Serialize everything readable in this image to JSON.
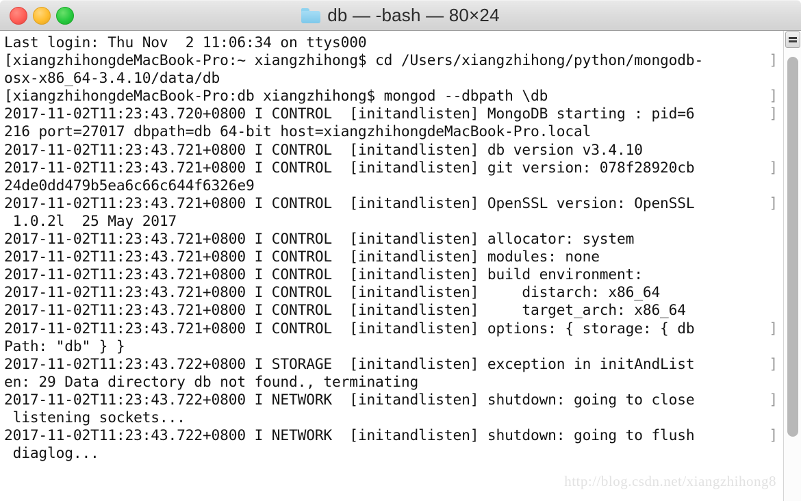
{
  "window": {
    "title": "db — -bash — 80×24",
    "folder_icon": "folder-icon",
    "traffic_lights": [
      {
        "name": "close-button",
        "label": "Close",
        "color": "#ff5f57"
      },
      {
        "name": "minimize-button",
        "label": "Minimize",
        "color": "#ffbd2e"
      },
      {
        "name": "maximize-button",
        "label": "Maximize",
        "color": "#28c940"
      }
    ]
  },
  "terminal": {
    "columns": 80,
    "rows": 24,
    "background": "#ffffff",
    "foreground": "#131313",
    "wrap_marker": "]",
    "lines": [
      "Last login: Thu Nov  2 11:06:34 on ttys000",
      "[xiangzhihongdeMacBook-Pro:~ xiangzhihong$ cd /Users/xiangzhihong/python/mongodb-",
      "osx-x86_64-3.4.10/data/db",
      "[xiangzhihongdeMacBook-Pro:db xiangzhihong$ mongod --dbpath \\db",
      "2017-11-02T11:23:43.720+0800 I CONTROL  [initandlisten] MongoDB starting : pid=6",
      "216 port=27017 dbpath=db 64-bit host=xiangzhihongdeMacBook-Pro.local",
      "2017-11-02T11:23:43.721+0800 I CONTROL  [initandlisten] db version v3.4.10",
      "2017-11-02T11:23:43.721+0800 I CONTROL  [initandlisten] git version: 078f28920cb",
      "24de0dd479b5ea6c66c644f6326e9",
      "2017-11-02T11:23:43.721+0800 I CONTROL  [initandlisten] OpenSSL version: OpenSSL",
      " 1.0.2l  25 May 2017",
      "2017-11-02T11:23:43.721+0800 I CONTROL  [initandlisten] allocator: system",
      "2017-11-02T11:23:43.721+0800 I CONTROL  [initandlisten] modules: none",
      "2017-11-02T11:23:43.721+0800 I CONTROL  [initandlisten] build environment:",
      "2017-11-02T11:23:43.721+0800 I CONTROL  [initandlisten]     distarch: x86_64",
      "2017-11-02T11:23:43.721+0800 I CONTROL  [initandlisten]     target_arch: x86_64",
      "2017-11-02T11:23:43.721+0800 I CONTROL  [initandlisten] options: { storage: { db",
      "Path: \"db\" } }",
      "2017-11-02T11:23:43.722+0800 I STORAGE  [initandlisten] exception in initAndList",
      "en: 29 Data directory db not found., terminating",
      "2017-11-02T11:23:43.722+0800 I NETWORK  [initandlisten] shutdown: going to close",
      " listening sockets...",
      "2017-11-02T11:23:43.722+0800 I NETWORK  [initandlisten] shutdown: going to flush",
      " diaglog..."
    ],
    "wrap_marker_lines": [
      1,
      3,
      4,
      7,
      9,
      16,
      18,
      20,
      22
    ]
  },
  "scrollbar": {
    "button_icon": "scroll-menu-icon",
    "thumb_position_percent": 6,
    "thumb_size_percent": 84
  },
  "watermark": {
    "text": "http://blog.csdn.net/xiangzhihong8"
  }
}
